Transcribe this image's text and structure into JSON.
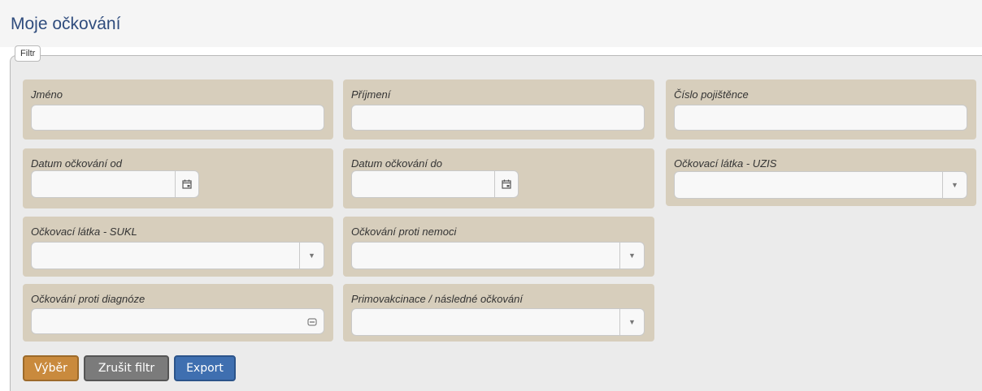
{
  "page": {
    "title": "Moje očkování"
  },
  "filter": {
    "legend": "Filtr",
    "fields": {
      "jmeno": {
        "label": "Jméno",
        "value": ""
      },
      "prijmeni": {
        "label": "Příjmení",
        "value": ""
      },
      "cislo_pojistence": {
        "label": "Číslo pojištěnce",
        "value": ""
      },
      "datum_od": {
        "label": "Datum očkování od",
        "value": ""
      },
      "datum_do": {
        "label": "Datum očkování do",
        "value": ""
      },
      "latka_uzis": {
        "label": "Očkovací látka - UZIS",
        "value": ""
      },
      "latka_sukl": {
        "label": "Očkovací látka - SUKL",
        "value": ""
      },
      "proti_nemoci": {
        "label": "Očkování proti nemoci",
        "value": ""
      },
      "proti_diagnoze": {
        "label": "Očkování proti diagnóze",
        "value": ""
      },
      "primovakcinace": {
        "label": "Primovakcinace / následné očkování",
        "value": ""
      }
    }
  },
  "buttons": {
    "vyber": "Výběr",
    "zrusit": "Zrušit filtr",
    "export": "Export"
  },
  "colors": {
    "panel": "#d7cebc",
    "vyber": "#c98a3d",
    "zrusit": "#7b7b7b",
    "export": "#3f6fb0",
    "title": "#2f4c7d"
  },
  "icons": {
    "calendar": "calendar-icon",
    "dropdown": "chevron-down-icon",
    "lookup": "lookup-icon"
  }
}
